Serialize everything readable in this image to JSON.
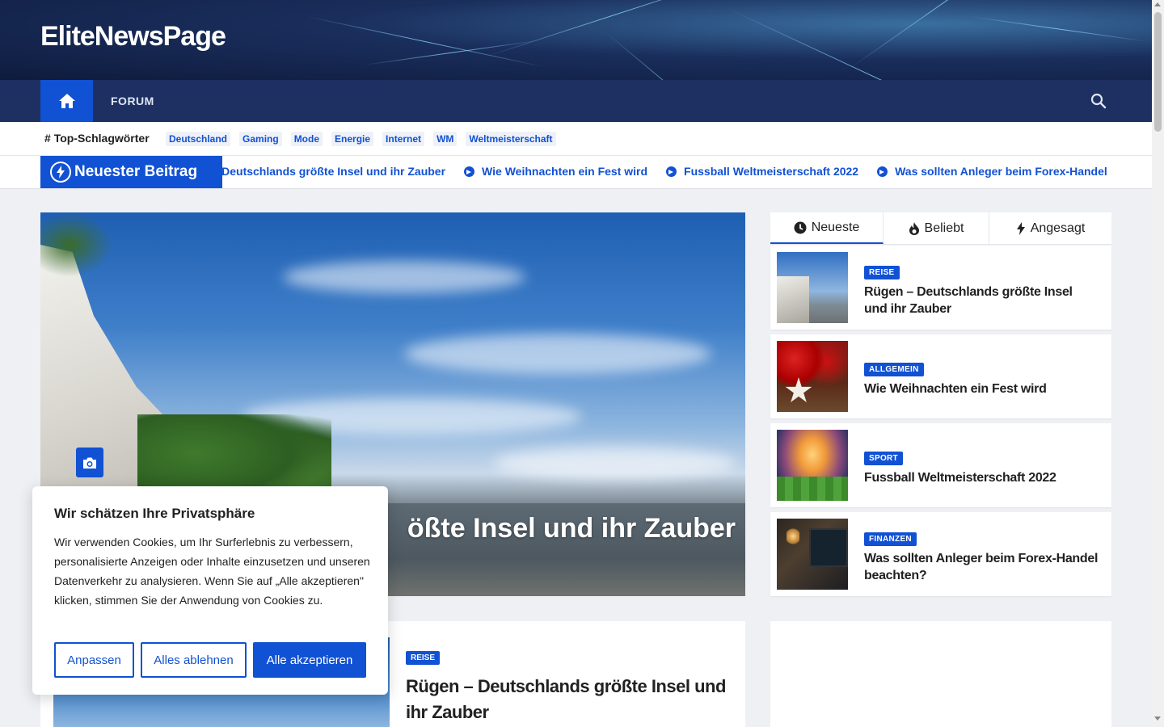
{
  "site": {
    "title": "EliteNewsPage"
  },
  "nav": {
    "home_icon": "home-icon",
    "forum_label": "FORUM",
    "search_icon": "search-icon"
  },
  "tags": {
    "title": "Top-Schlagwörter",
    "items": [
      "Deutschland",
      "Gaming",
      "Mode",
      "Energie",
      "Internet",
      "WM",
      "Weltmeisterschaft"
    ]
  },
  "ticker": {
    "label": "Neuester Beitrag",
    "items": [
      "Rügen – Deutschlands größte Insel und ihr Zauber",
      "Wie Weihnachten ein Fest wird",
      "Fussball Weltmeisterschaft 2022",
      "Was sollten Anleger beim Forex-Handel"
    ]
  },
  "hero": {
    "title": "Rügen – Deutschlands größte Insel und ihr Zauber",
    "title_visible": "ößte Insel und ihr Zauber"
  },
  "sidebar": {
    "tabs": [
      {
        "label": "Neueste",
        "icon": "clock-icon"
      },
      {
        "label": "Beliebt",
        "icon": "fire-icon"
      },
      {
        "label": "Angesagt",
        "icon": "bolt-icon"
      }
    ],
    "posts": [
      {
        "category": "REISE",
        "title": "Rügen – Deutschlands größte Insel und ihr Zauber"
      },
      {
        "category": "ALLGEMEIN",
        "title": "Wie Weihnachten ein Fest wird"
      },
      {
        "category": "SPORT",
        "title": "Fussball Weltmeisterschaft 2022"
      },
      {
        "category": "FINANZEN",
        "title": "Was sollten Anleger beim Forex-Handel beachten?"
      }
    ]
  },
  "card2": {
    "category": "REISE",
    "title": "Rügen – Deutschlands größte Insel und ihr Zauber"
  },
  "cookie": {
    "title": "Wir schätzen Ihre Privatsphäre",
    "text": "Wir verwenden Cookies, um Ihr Surferlebnis zu verbessern, personalisierte Anzeigen oder Inhalte einzusetzen und unseren Datenverkehr zu analysieren. Wenn Sie auf „Alle akzeptieren\" klicken, stimmen Sie der Anwendung von Cookies zu.",
    "btn_customize": "Anpassen",
    "btn_reject": "Alles ablehnen",
    "btn_accept": "Alle akzeptieren"
  },
  "colors": {
    "accent": "#1151d3",
    "nav_bg": "#1e3062",
    "page_bg": "#eef0f4"
  }
}
